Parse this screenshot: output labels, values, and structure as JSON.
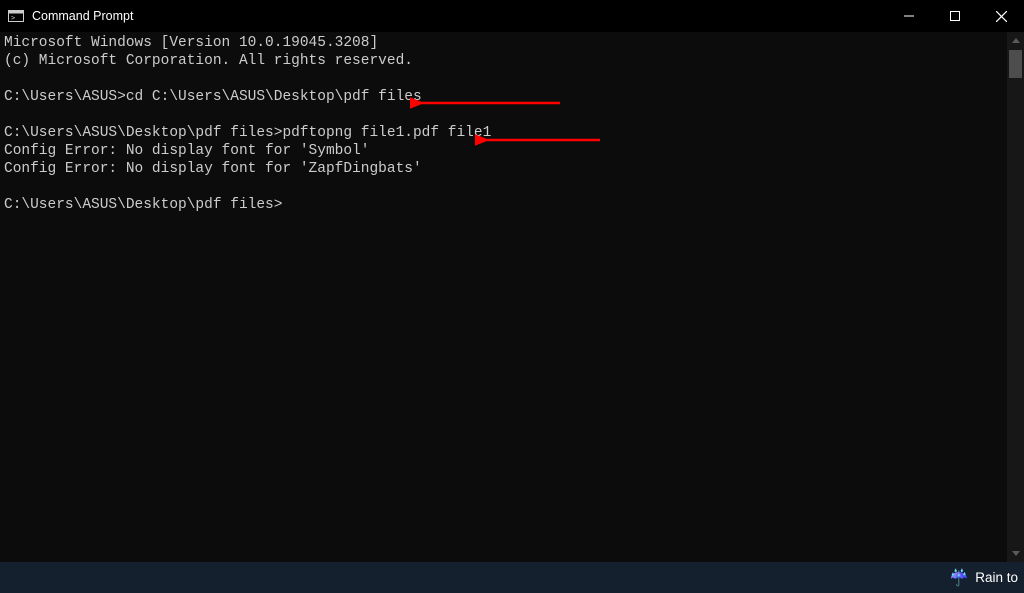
{
  "window": {
    "title": "Command Prompt"
  },
  "terminal": {
    "lines": [
      "Microsoft Windows [Version 10.0.19045.3208]",
      "(c) Microsoft Corporation. All rights reserved.",
      "",
      "C:\\Users\\ASUS>cd C:\\Users\\ASUS\\Desktop\\pdf files",
      "",
      "C:\\Users\\ASUS\\Desktop\\pdf files>pdftopng file1.pdf file1",
      "Config Error: No display font for 'Symbol'",
      "Config Error: No display font for 'ZapfDingbats'",
      "",
      "C:\\Users\\ASUS\\Desktop\\pdf files>"
    ]
  },
  "taskbar": {
    "weather_label": "Rain to"
  },
  "annotations": {
    "arrow_color": "#ff0000"
  }
}
